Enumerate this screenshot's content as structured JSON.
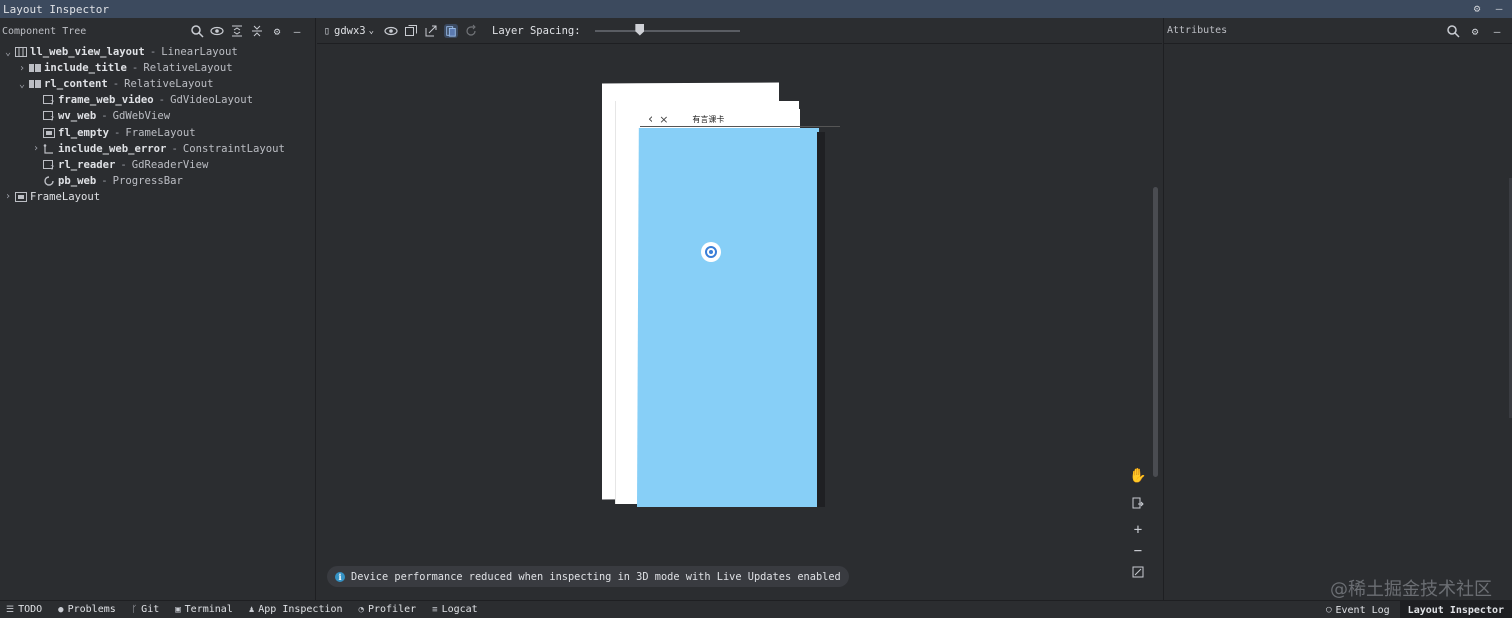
{
  "window": {
    "title": "Layout Inspector"
  },
  "component_tree": {
    "header": "Component Tree",
    "nodes": [
      {
        "name": "ll_web_view_layout",
        "cls": "LinearLayout"
      },
      {
        "name": "include_title",
        "cls": "RelativeLayout"
      },
      {
        "name": "rl_content",
        "cls": "RelativeLayout"
      },
      {
        "name": "frame_web_video",
        "cls": "GdVideoLayout"
      },
      {
        "name": "wv_web",
        "cls": "GdWebView"
      },
      {
        "name": "fl_empty",
        "cls": "FrameLayout"
      },
      {
        "name": "include_web_error",
        "cls": "ConstraintLayout"
      },
      {
        "name": "rl_reader",
        "cls": "GdReaderView"
      },
      {
        "name": "pb_web",
        "cls": "ProgressBar"
      },
      {
        "name": "FrameLayout",
        "cls": ""
      }
    ]
  },
  "toolbar": {
    "device": "gdwx3",
    "layer_spacing_label": "Layer Spacing:",
    "layer_spacing_level": 0.3
  },
  "preview": {
    "nav_title": "有言课卡",
    "screen_color": "#87cff7"
  },
  "notice": {
    "text": "Device performance reduced when inspecting in 3D mode with Live Updates enabled"
  },
  "attributes": {
    "header": "Attributes"
  },
  "statusbar": {
    "items": [
      "TODO",
      "Problems",
      "Git",
      "Terminal",
      "App Inspection",
      "Profiler",
      "Logcat"
    ],
    "right_items": [
      "Event Log",
      "Layout Inspector"
    ]
  },
  "watermark": "@稀土掘金技术社区"
}
